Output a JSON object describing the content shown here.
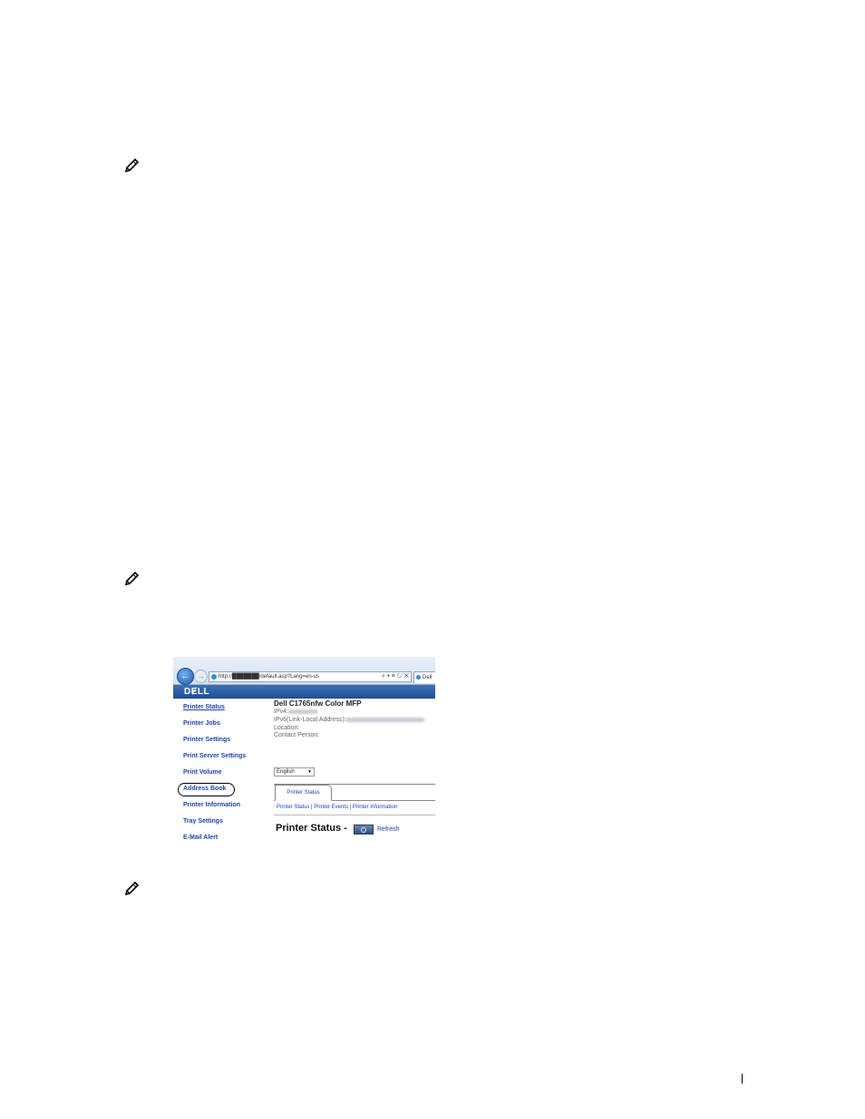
{
  "browser": {
    "url": "http://███████/default.asp?Lang=en-us",
    "address_tools": "⌕ ▾ ≡ ↻ ✕",
    "tab_label": "Dell"
  },
  "page_header": {
    "logo": "DɆLL"
  },
  "sidebar": {
    "items": [
      {
        "label": "Printer Status"
      },
      {
        "label": "Printer Jobs"
      },
      {
        "label": "Printer Settings"
      },
      {
        "label": "Print Server Settings"
      },
      {
        "label": "Print Volume"
      },
      {
        "label": "Address Book"
      },
      {
        "label": "Printer Information"
      },
      {
        "label": "Tray Settings"
      },
      {
        "label": "E-Mail Alert"
      }
    ]
  },
  "printer": {
    "model": "Dell C1765nfw Color MFP",
    "ipv4_label": "IPv4:",
    "ipv6_label": "IPv6(Link-Local Address):",
    "location_label": "Location:",
    "contact_label": "Contact Person:"
  },
  "language": {
    "selected": "English"
  },
  "tabs": {
    "active": "Printer Status"
  },
  "sub_nav": {
    "items": [
      "Printer Status",
      "Printer Events",
      "Printer Information"
    ],
    "separator": "|"
  },
  "status_section": {
    "heading": "Printer Status -",
    "refresh_label": "Refresh"
  },
  "icons": {
    "note": "pencil-note-icon",
    "back": "back-arrow-icon",
    "refresh": "refresh-icon"
  }
}
